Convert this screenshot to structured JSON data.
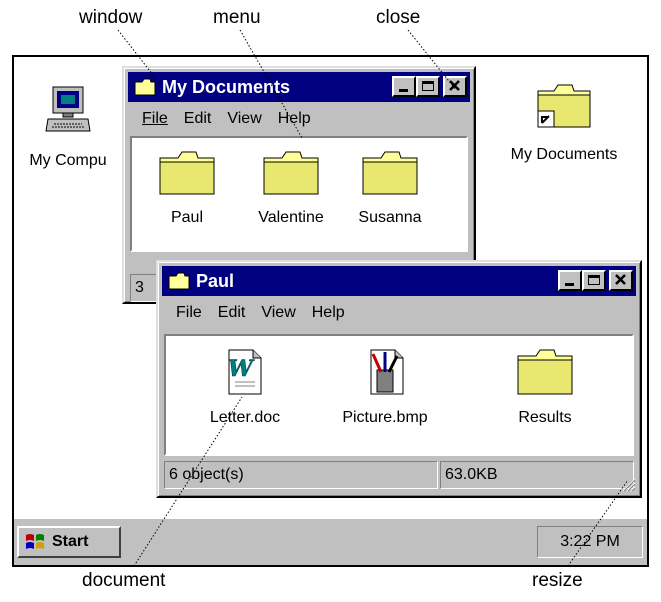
{
  "callouts": {
    "window": "window",
    "menu": "menu",
    "close": "close",
    "document": "document",
    "resize": "resize"
  },
  "desktop": {
    "icons": [
      {
        "label": "My Compu",
        "icon": "computer-icon"
      },
      {
        "label": "My Documents",
        "icon": "folder-shortcut-icon"
      }
    ]
  },
  "taskbar": {
    "start_label": "Start",
    "clock": "3:22 PM"
  },
  "window_back": {
    "title": "My Documents",
    "menu": [
      "File",
      "Edit",
      "View",
      "Help"
    ],
    "files": [
      {
        "label": "Paul",
        "icon": "folder-icon"
      },
      {
        "label": "Valentine",
        "icon": "folder-icon"
      },
      {
        "label": "Susanna",
        "icon": "folder-icon"
      }
    ],
    "status_partial": "3"
  },
  "window_front": {
    "title": "Paul",
    "menu": [
      "File",
      "Edit",
      "View",
      "Help"
    ],
    "files": [
      {
        "label": "Letter.doc",
        "icon": "word-document-icon"
      },
      {
        "label": "Picture.bmp",
        "icon": "paint-bitmap-icon"
      },
      {
        "label": "Results",
        "icon": "folder-icon"
      }
    ],
    "status": {
      "objects": "6 object(s)",
      "size": "63.0KB"
    }
  }
}
